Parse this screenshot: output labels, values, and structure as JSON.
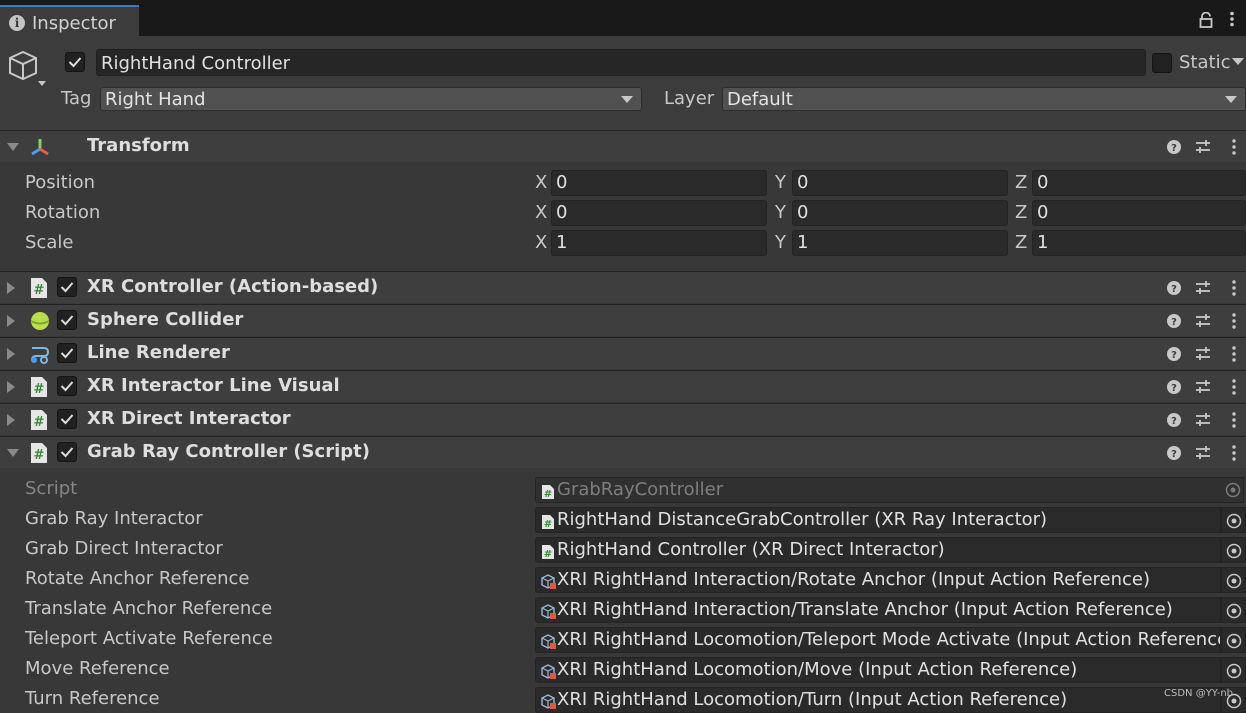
{
  "tab": {
    "label": "Inspector"
  },
  "object": {
    "name": "RightHand Controller",
    "static_label": "Static"
  },
  "tag": {
    "label": "Tag",
    "value": "Right Hand"
  },
  "layer": {
    "label": "Layer",
    "value": "Default"
  },
  "transform": {
    "title": "Transform",
    "rows": [
      {
        "label": "Position",
        "x": "0",
        "y": "0",
        "z": "0"
      },
      {
        "label": "Rotation",
        "x": "0",
        "y": "0",
        "z": "0"
      },
      {
        "label": "Scale",
        "x": "1",
        "y": "1",
        "z": "1"
      }
    ],
    "axis": {
      "x": "X",
      "y": "Y",
      "z": "Z"
    }
  },
  "components": [
    {
      "title": "XR Controller (Action-based)",
      "icon": "script-icon"
    },
    {
      "title": "Sphere Collider",
      "icon": "sphere-collider-icon"
    },
    {
      "title": "Line Renderer",
      "icon": "line-renderer-icon"
    },
    {
      "title": "XR Interactor Line Visual",
      "icon": "script-icon"
    },
    {
      "title": "XR Direct Interactor",
      "icon": "script-icon"
    },
    {
      "title": "Grab Ray Controller (Script)",
      "icon": "script-icon"
    }
  ],
  "grab_ray": {
    "fields": [
      {
        "label": "Script",
        "value": "GrabRayController",
        "icon": "script-icon"
      },
      {
        "label": "Grab Ray Interactor",
        "value": "RightHand DistanceGrabController (XR Ray Interactor)",
        "icon": "script-icon"
      },
      {
        "label": "Grab Direct Interactor",
        "value": "RightHand Controller (XR Direct Interactor)",
        "icon": "script-icon"
      },
      {
        "label": "Rotate Anchor Reference",
        "value": "XRI RightHand Interaction/Rotate Anchor (Input Action Reference)",
        "icon": "input-action-icon"
      },
      {
        "label": "Translate Anchor Reference",
        "value": "XRI RightHand Interaction/Translate Anchor (Input Action Reference)",
        "icon": "input-action-icon"
      },
      {
        "label": "Teleport Activate Reference",
        "value": "XRI RightHand Locomotion/Teleport Mode Activate (Input Action Reference)",
        "icon": "input-action-icon"
      },
      {
        "label": "Move Reference",
        "value": "XRI RightHand Locomotion/Move (Input Action Reference)",
        "icon": "input-action-icon"
      },
      {
        "label": "Turn Reference",
        "value": "XRI RightHand Locomotion/Turn (Input Action Reference)",
        "icon": "input-action-icon"
      }
    ]
  },
  "watermark": "CSDN @YY-nb"
}
